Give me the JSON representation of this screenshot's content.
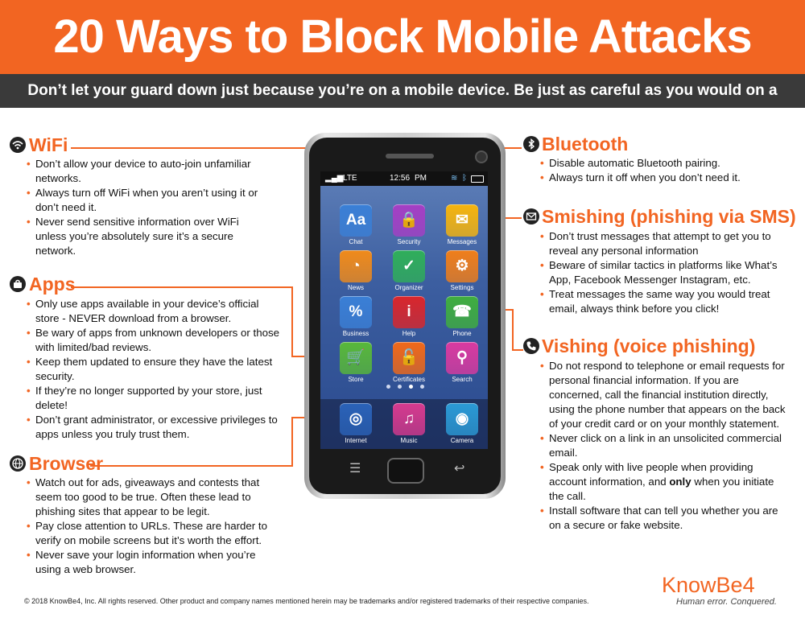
{
  "header": {
    "title": "20 Ways to Block Mobile Attacks",
    "subtitle": "Don’t let your guard down just because you’re on a mobile device. Be just as careful as you would on a desktop!"
  },
  "colors": {
    "accent": "#f26522",
    "dark_band": "#3a3a3a"
  },
  "sections": {
    "wifi": {
      "icon": "wifi-icon",
      "title": "WiFi",
      "items": [
        "Don’t allow your device to auto-join unfamiliar networks.",
        "Always turn off WiFi when you aren’t using it or don’t need it.",
        "Never send sensitive information over WiFi unless you’re absolutely sure it’s a secure network."
      ]
    },
    "apps": {
      "icon": "apps-icon",
      "title": "Apps",
      "items": [
        "Only use apps available in your device’s official store - NEVER download from a browser.",
        "Be wary of apps from unknown developers or those with limited/bad reviews.",
        "Keep them updated to ensure they have the latest security.",
        "If they’re no longer supported by your store, just delete!",
        "Don’t grant administrator, or excessive  privileges to apps unless you truly trust them."
      ]
    },
    "browser": {
      "icon": "globe-icon",
      "title": "Browser",
      "items": [
        "Watch out for ads, giveaways and contests that seem too good to be true. Often these lead to phishing sites that appear to be legit.",
        "Pay close attention to URLs. These are harder to verify on mobile screens but it’s worth the effort.",
        "Never save your login information when you’re using a web browser."
      ]
    },
    "bluetooth": {
      "icon": "bluetooth-icon",
      "title": "Bluetooth",
      "items": [
        "Disable automatic Bluetooth pairing.",
        "Always turn it off when you don’t need it."
      ]
    },
    "smishing": {
      "icon": "envelope-icon",
      "title": "Smishing (phishing via SMS)",
      "items": [
        "Don’t trust messages that attempt to get you to reveal any personal information",
        "Beware of similar tactics in platforms like What’s App, Facebook Messenger Instagram, etc.",
        "Treat messages the same way you would treat email, always think before you click!"
      ]
    },
    "vishing": {
      "icon": "phone-icon",
      "title": "Vishing (voice phishing)",
      "items": [
        "Do not respond to telephone or email requests for personal financial information. If you are concerned, call the financial institution directly, using the phone number that appears on the back of your credit card or on your monthly statement.",
        "Never click on a link in an unsolicited commercial email."
      ],
      "item3_pre": "Speak only with live people when providing account information, and ",
      "item3_bold": "only",
      "item3_post": " when you initiate the call.",
      "item4": "Install software that can tell you whether you are on a secure or fake website."
    }
  },
  "phone": {
    "status_signal": "LTE",
    "status_time": "12:56",
    "status_ampm": "PM",
    "apps": [
      {
        "label": "Chat",
        "color": "#3a7fd6",
        "glyph": "Aa",
        "icon": "chat-icon"
      },
      {
        "label": "Security",
        "color": "#a43fc4",
        "glyph": "🔒",
        "icon": "lock-icon"
      },
      {
        "label": "Messages",
        "color": "#f5b40d",
        "glyph": "✉",
        "icon": "envelope-icon"
      },
      {
        "label": "News",
        "color": "#f08a1a",
        "glyph": "◔",
        "icon": "rss-icon"
      },
      {
        "label": "Organizer",
        "color": "#2fae5a",
        "glyph": "✓",
        "icon": "check-icon"
      },
      {
        "label": "Settings",
        "color": "#f07e1a",
        "glyph": "⚙",
        "icon": "gear-icon"
      },
      {
        "label": "Business",
        "color": "#3a7fd6",
        "glyph": "%",
        "icon": "percent-icon"
      },
      {
        "label": "Help",
        "color": "#d9262c",
        "glyph": "i",
        "icon": "info-icon"
      },
      {
        "label": "Phone",
        "color": "#3fae3f",
        "glyph": "☎",
        "icon": "phone-icon"
      },
      {
        "label": "Store",
        "color": "#58b83a",
        "glyph": "🛒",
        "icon": "cart-icon"
      },
      {
        "label": "Certificates",
        "color": "#f0691a",
        "glyph": "🔓",
        "icon": "unlock-icon"
      },
      {
        "label": "Search",
        "color": "#d93aa0",
        "glyph": "⚲",
        "icon": "search-icon"
      }
    ],
    "dock": [
      {
        "label": "Internet",
        "color": "#2a62b8",
        "glyph": "◎",
        "icon": "globe-icon"
      },
      {
        "label": "Music",
        "color": "#d63a8f",
        "glyph": "♫",
        "icon": "music-icon"
      },
      {
        "label": "Camera",
        "color": "#2b9ad6",
        "glyph": "◉",
        "icon": "camera-icon"
      }
    ]
  },
  "footer": {
    "copyright": "© 2018 KnowBe4, Inc.  All rights reserved.  Other product and company names mentioned herein may be trademarks and/or registered trademarks of their respective companies.",
    "brand": "KnowBe4",
    "tagline": "Human error. Conquered."
  }
}
